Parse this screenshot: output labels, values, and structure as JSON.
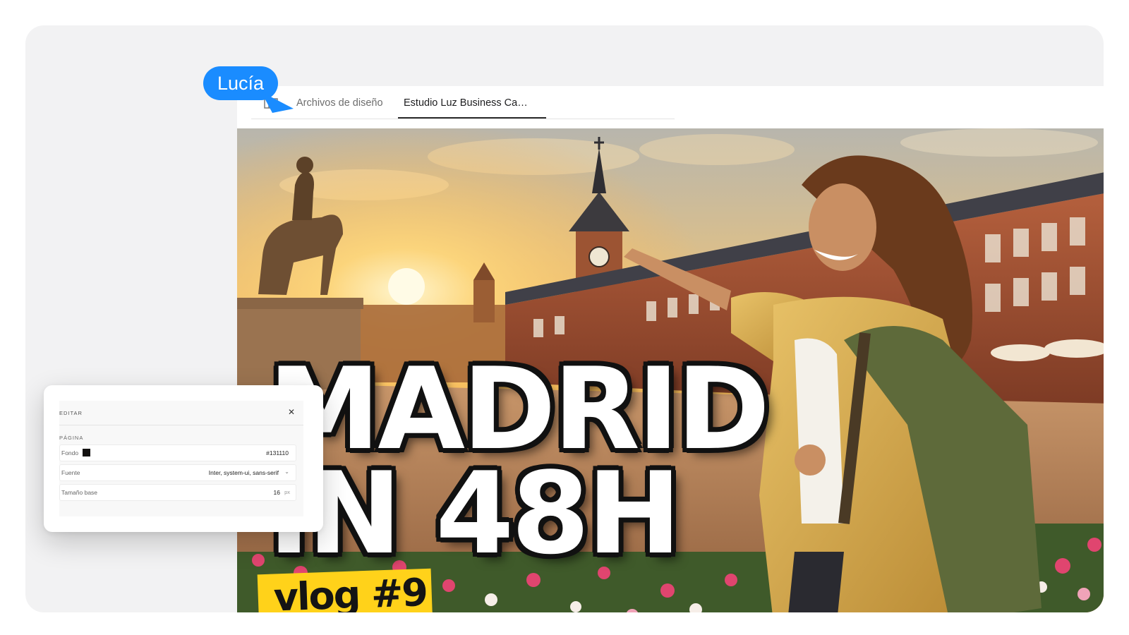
{
  "collaborator": {
    "name": "Lucía",
    "color": "#1a8cff"
  },
  "tabs": [
    {
      "label": "Archivos de diseño",
      "active": false
    },
    {
      "label": "Estudio Luz Business Ca…",
      "active": true
    }
  ],
  "thumbnail": {
    "headline_line1": "MADRID",
    "headline_line2": "IN 48H",
    "badge": "vlog #9",
    "badge_color": "#ffd21a"
  },
  "edit_panel": {
    "title": "EDITAR",
    "close_icon": "close-icon",
    "section": "PÁGINA",
    "fields": {
      "background": {
        "label": "Fondo",
        "value": "#131110"
      },
      "font": {
        "label": "Fuente",
        "value": "Inter, system-ui, sans-serif"
      },
      "base_size": {
        "label": "Tamaño base",
        "value": "16",
        "unit": "px"
      }
    }
  }
}
